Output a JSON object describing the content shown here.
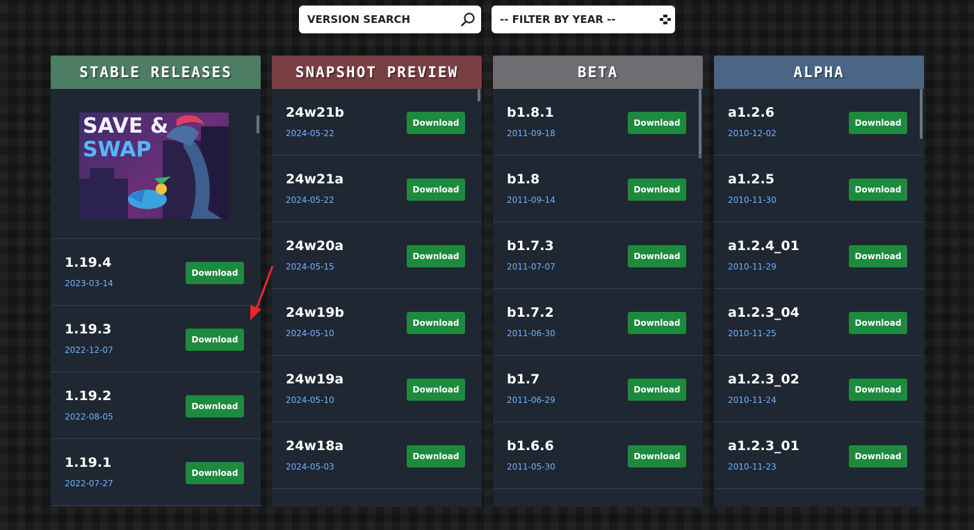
{
  "search": {
    "placeholder": "VERSION SEARCH",
    "icon": "search-icon"
  },
  "filter": {
    "label": "-- FILTER BY YEAR --",
    "icon": "select-arrows-icon"
  },
  "download_label": "Download",
  "colors": {
    "stable": "#4e7d66",
    "snapshot": "#7a3f43",
    "beta": "#6f6c72",
    "alpha": "#4b6584",
    "download": "#1e8a3e",
    "date": "#6fb3ff"
  },
  "promo": {
    "line1": "SAVE &",
    "line2": "SWAP"
  },
  "columns": {
    "stable": {
      "title": "STABLE RELEASES",
      "items": [
        {
          "version": "1.19.4",
          "date": "2023-03-14"
        },
        {
          "version": "1.19.3",
          "date": "2022-12-07"
        },
        {
          "version": "1.19.2",
          "date": "2022-08-05"
        },
        {
          "version": "1.19.1",
          "date": "2022-07-27"
        }
      ]
    },
    "snapshot": {
      "title": "SNAPSHOT PREVIEW",
      "items": [
        {
          "version": "24w21b",
          "date": "2024-05-22"
        },
        {
          "version": "24w21a",
          "date": "2024-05-22"
        },
        {
          "version": "24w20a",
          "date": "2024-05-15"
        },
        {
          "version": "24w19b",
          "date": "2024-05-10"
        },
        {
          "version": "24w19a",
          "date": "2024-05-10"
        },
        {
          "version": "24w18a",
          "date": "2024-05-03"
        }
      ]
    },
    "beta": {
      "title": "BETA",
      "items": [
        {
          "version": "b1.8.1",
          "date": "2011-09-18"
        },
        {
          "version": "b1.8",
          "date": "2011-09-14"
        },
        {
          "version": "b1.7.3",
          "date": "2011-07-07"
        },
        {
          "version": "b1.7.2",
          "date": "2011-06-30"
        },
        {
          "version": "b1.7",
          "date": "2011-06-29"
        },
        {
          "version": "b1.6.6",
          "date": "2011-05-30"
        }
      ]
    },
    "alpha": {
      "title": "ALPHA",
      "items": [
        {
          "version": "a1.2.6",
          "date": "2010-12-02"
        },
        {
          "version": "a1.2.5",
          "date": "2010-11-30"
        },
        {
          "version": "a1.2.4_01",
          "date": "2010-11-29"
        },
        {
          "version": "a1.2.3_04",
          "date": "2010-11-25"
        },
        {
          "version": "a1.2.3_02",
          "date": "2010-11-24"
        },
        {
          "version": "a1.2.3_01",
          "date": "2010-11-23"
        }
      ]
    }
  }
}
